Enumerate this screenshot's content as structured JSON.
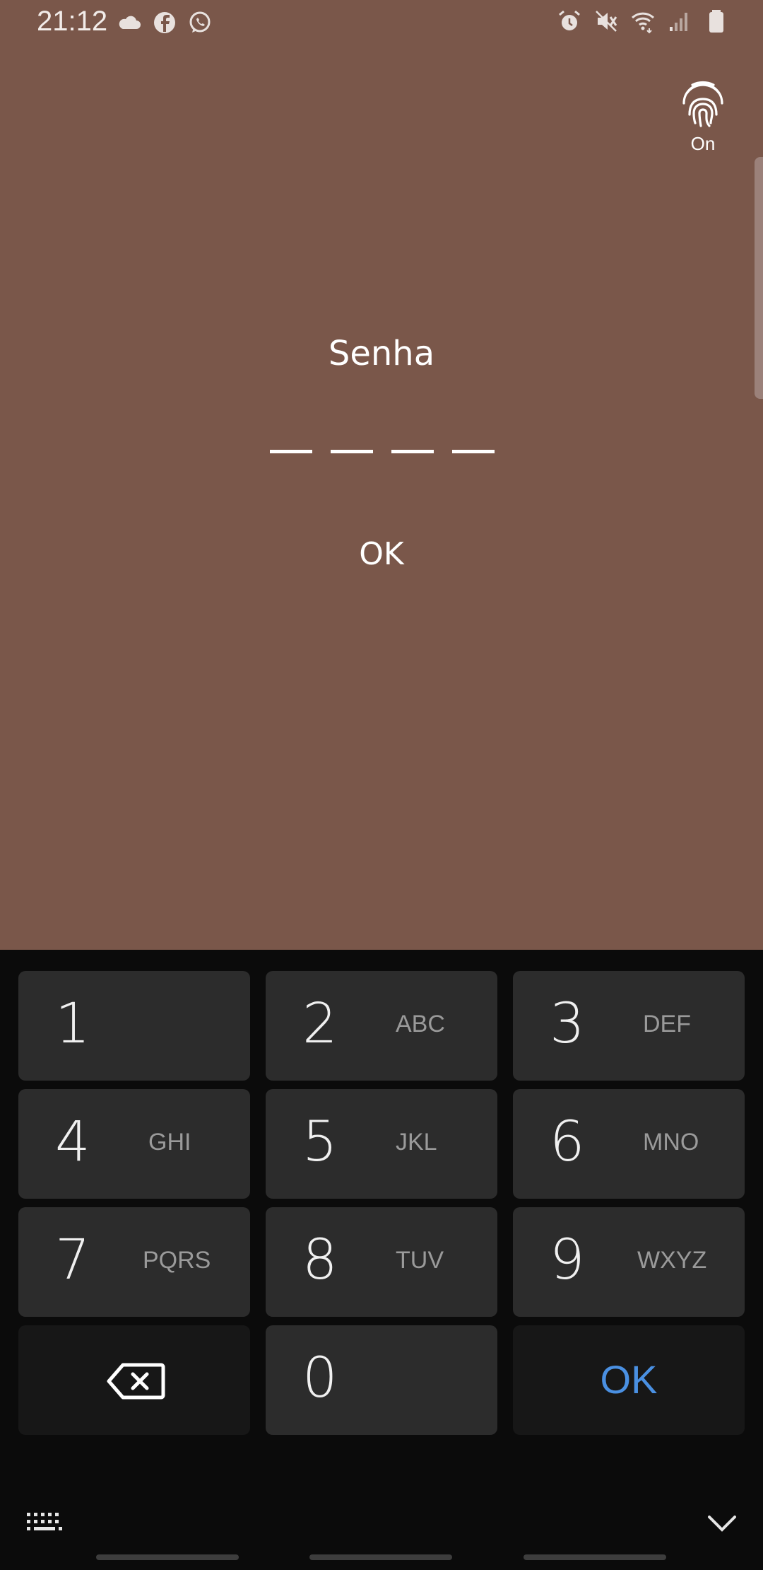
{
  "status_bar": {
    "time": "21:12",
    "left_icons": [
      "cloud-icon",
      "facebook-icon",
      "whatsapp-icon"
    ],
    "right_icons": [
      "alarm-icon",
      "mute-icon",
      "wifi-icon",
      "signal-icon",
      "battery-icon"
    ]
  },
  "fingerprint": {
    "icon": "fingerprint-icon",
    "label": "On"
  },
  "password": {
    "title": "Senha",
    "pin_length": 4,
    "ok_label": "OK"
  },
  "keypad": {
    "keys": [
      {
        "digit": "1",
        "letters": ""
      },
      {
        "digit": "2",
        "letters": "ABC"
      },
      {
        "digit": "3",
        "letters": "DEF"
      },
      {
        "digit": "4",
        "letters": "GHI"
      },
      {
        "digit": "5",
        "letters": "JKL"
      },
      {
        "digit": "6",
        "letters": "MNO"
      },
      {
        "digit": "7",
        "letters": "PQRS"
      },
      {
        "digit": "8",
        "letters": "TUV"
      },
      {
        "digit": "9",
        "letters": "WXYZ"
      },
      {
        "digit": "0",
        "letters": ""
      }
    ],
    "backspace_icon": "backspace-icon",
    "ok_label": "OK",
    "keyboard_switch_icon": "keyboard-icon",
    "hide_icon": "chevron-down-icon"
  },
  "colors": {
    "background": "#7a574a",
    "keyboard_bg": "#0b0b0b",
    "key_bg": "#2c2c2c",
    "ok_accent": "#4a90e2"
  }
}
